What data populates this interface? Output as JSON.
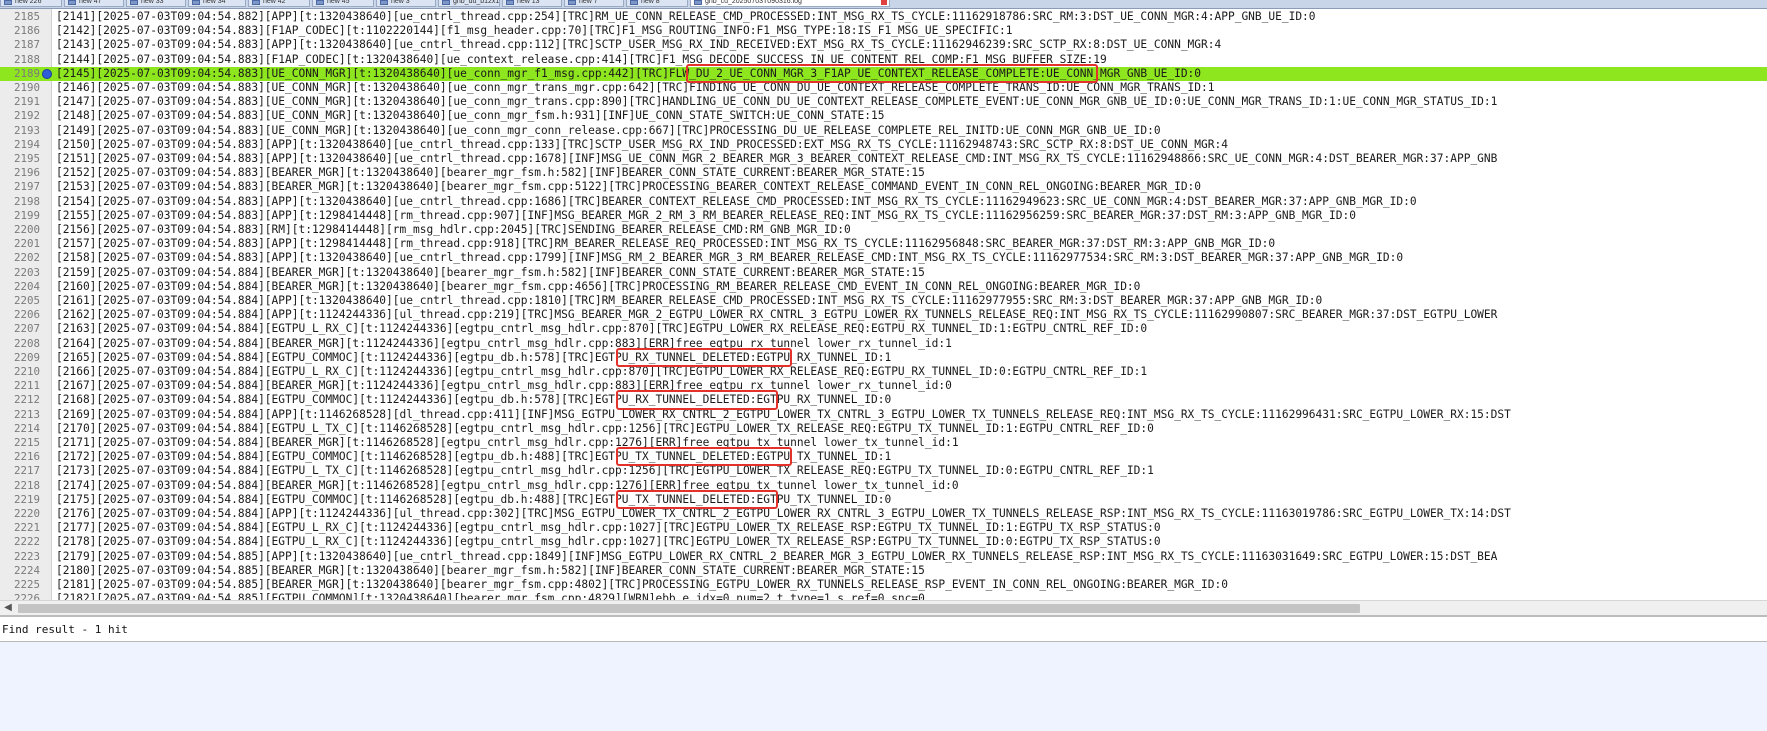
{
  "tabs": [
    {
      "label": "new 226"
    },
    {
      "label": "new 47"
    },
    {
      "label": "new 33"
    },
    {
      "label": "new 34"
    },
    {
      "label": "new 42"
    },
    {
      "label": "new 45"
    },
    {
      "label": "new 3"
    },
    {
      "label": "gnb_du_b12x1.1.log"
    },
    {
      "label": "new 13"
    },
    {
      "label": "new 7"
    },
    {
      "label": "new 8"
    },
    {
      "label": "gnb_cu_20250703T090316.log"
    }
  ],
  "log": {
    "lines": [
      {
        "ln": "2185",
        "text": "[2141][2025-07-03T09:04:54.882][APP][t:1320438640][ue_cntrl_thread.cpp:254][TRC]RM_UE_CONN_RELEASE_CMD_PROCESSED:INT_MSG_RX_TS_CYCLE:11162918786:SRC_RM:3:DST_UE_CONN_MGR:4:APP_GNB_UE_ID:0"
      },
      {
        "ln": "2186",
        "text": "[2142][2025-07-03T09:04:54.883][F1AP_CODEC][t:1102220144][f1_msg_header.cpp:70][TRC]F1_MSG_ROUTING_INFO:F1_MSG_TYPE:18:IS_F1_MSG_UE_SPECIFIC:1"
      },
      {
        "ln": "2187",
        "text": "[2143][2025-07-03T09:04:54.883][APP][t:1320438640][ue_cntrl_thread.cpp:112][TRC]SCTP_USER_MSG_RX_IND_RECEIVED:EXT_MSG_RX_TS_CYCLE:11162946239:SRC_SCTP_RX:8:DST_UE_CONN_MGR:4"
      },
      {
        "ln": "2188",
        "text": "[2144][2025-07-03T09:04:54.883][F1AP_CODEC][t:1320438640][ue_context_release.cpp:414][TRC]F1_MSG_DECODE_SUCCESS_IN_UE_CONTENT_REL_COMP:F1_MSG_BUFFER_SIZE:19"
      },
      {
        "ln": "2189",
        "text": "[2145][2025-07-03T09:04:54.883][UE_CONN_MGR][t:1320438640][ue_conn_mgr_f1_msg.cpp:442][TRC]FLW_DU_2_UE_CONN_MGR_3_F1AP_UE_CONTEXT_RELEASE_COMPLETE:UE_CONN_MGR_GNB_UE_ID:0"
      },
      {
        "ln": "2190",
        "text": "[2146][2025-07-03T09:04:54.883][UE_CONN_MGR][t:1320438640][ue_conn_mgr_trans_mgr.cpp:642][TRC]FINDING_UE_CONN_DU_UE_CONTEXT_RELEASE_COMPLETE_TRANS_ID:UE_CONN_MGR_TRANS_ID:1"
      },
      {
        "ln": "2191",
        "text": "[2147][2025-07-03T09:04:54.883][UE_CONN_MGR][t:1320438640][ue_conn_mgr_trans.cpp:890][TRC]HANDLING_UE_CONN_DU_UE_CONTEXT_RELEASE_COMPLETE_EVENT:UE_CONN_MGR_GNB_UE_ID:0:UE_CONN_MGR_TRANS_ID:1:UE_CONN_MGR_STATUS_ID:1"
      },
      {
        "ln": "2192",
        "text": "[2148][2025-07-03T09:04:54.883][UE_CONN_MGR][t:1320438640][ue_conn_mgr_fsm.h:931][INF]UE_CONN_STATE_SWITCH:UE_CONN_STATE:15"
      },
      {
        "ln": "2193",
        "text": "[2149][2025-07-03T09:04:54.883][UE_CONN_MGR][t:1320438640][ue_conn_mgr_conn_release.cpp:667][TRC]PROCESSING_DU_UE_RELEASE_COMPLETE_REL_INITD:UE_CONN_MGR_GNB_UE_ID:0"
      },
      {
        "ln": "2194",
        "text": "[2150][2025-07-03T09:04:54.883][APP][t:1320438640][ue_cntrl_thread.cpp:133][TRC]SCTP_USER_MSG_RX_IND_PROCESSED:EXT_MSG_RX_TS_CYCLE:11162948743:SRC_SCTP_RX:8:DST_UE_CONN_MGR:4"
      },
      {
        "ln": "2195",
        "text": "[2151][2025-07-03T09:04:54.883][APP][t:1320438640][ue_cntrl_thread.cpp:1678][INF]MSG_UE_CONN_MGR_2_BEARER_MGR_3_BEARER_CONTEXT_RELEASE_CMD:INT_MSG_RX_TS_CYCLE:11162948866:SRC_UE_CONN_MGR:4:DST_BEARER_MGR:37:APP_GNB"
      },
      {
        "ln": "2196",
        "text": "[2152][2025-07-03T09:04:54.883][BEARER_MGR][t:1320438640][bearer_mgr_fsm.h:582][INF]BEARER_CONN_STATE_CURRENT:BEARER_MGR_STATE:15"
      },
      {
        "ln": "2197",
        "text": "[2153][2025-07-03T09:04:54.883][BEARER_MGR][t:1320438640][bearer_mgr_fsm.cpp:5122][TRC]PROCESSING_BEARER_CONTEXT_RELEASE_COMMAND_EVENT_IN_CONN_REL_ONGOING:BEARER_MGR_ID:0"
      },
      {
        "ln": "2198",
        "text": "[2154][2025-07-03T09:04:54.883][APP][t:1320438640][ue_cntrl_thread.cpp:1686][TRC]BEARER_CONTEXT_RELEASE_CMD_PROCESSED:INT_MSG_RX_TS_CYCLE:11162949623:SRC_UE_CONN_MGR:4:DST_BEARER_MGR:37:APP_GNB_MGR_ID:0"
      },
      {
        "ln": "2199",
        "text": "[2155][2025-07-03T09:04:54.883][APP][t:1298414448][rm_thread.cpp:907][INF]MSG_BEARER_MGR_2_RM_3_RM_BEARER_RELEASE_REQ:INT_MSG_RX_TS_CYCLE:11162956259:SRC_BEARER_MGR:37:DST_RM:3:APP_GNB_MGR_ID:0"
      },
      {
        "ln": "2200",
        "text": "[2156][2025-07-03T09:04:54.883][RM][t:1298414448][rm_msg_hdlr.cpp:2045][TRC]SENDING_BEARER_RELEASE_CMD:RM_GNB_MGR_ID:0"
      },
      {
        "ln": "2201",
        "text": "[2157][2025-07-03T09:04:54.883][APP][t:1298414448][rm_thread.cpp:918][TRC]RM_BEARER_RELEASE_REQ_PROCESSED:INT_MSG_RX_TS_CYCLE:11162956848:SRC_BEARER_MGR:37:DST_RM:3:APP_GNB_MGR_ID:0"
      },
      {
        "ln": "2202",
        "text": "[2158][2025-07-03T09:04:54.883][APP][t:1320438640][ue_cntrl_thread.cpp:1799][INF]MSG_RM_2_BEARER_MGR_3_RM_BEARER_RELEASE_CMD:INT_MSG_RX_TS_CYCLE:11162977534:SRC_RM:3:DST_BEARER_MGR:37:APP_GNB_MGR_ID:0"
      },
      {
        "ln": "2203",
        "text": "[2159][2025-07-03T09:04:54.884][BEARER_MGR][t:1320438640][bearer_mgr_fsm.h:582][INF]BEARER_CONN_STATE_CURRENT:BEARER_MGR_STATE:15"
      },
      {
        "ln": "2204",
        "text": "[2160][2025-07-03T09:04:54.884][BEARER_MGR][t:1320438640][bearer_mgr_fsm.cpp:4656][TRC]PROCESSING_RM_BEARER_RELEASE_CMD_EVENT_IN_CONN_REL_ONGOING:BEARER_MGR_ID:0"
      },
      {
        "ln": "2205",
        "text": "[2161][2025-07-03T09:04:54.884][APP][t:1320438640][ue_cntrl_thread.cpp:1810][TRC]RM_BEARER_RELEASE_CMD_PROCESSED:INT_MSG_RX_TS_CYCLE:11162977955:SRC_RM:3:DST_BEARER_MGR:37:APP_GNB_MGR_ID:0"
      },
      {
        "ln": "2206",
        "text": "[2162][2025-07-03T09:04:54.884][APP][t:1124244336][ul_thread.cpp:219][TRC]MSG_BEARER_MGR_2_EGTPU_LOWER_RX_CNTRL_3_EGTPU_LOWER_RX_TUNNELS_RELEASE_REQ:INT_MSG_RX_TS_CYCLE:11162990807:SRC_BEARER_MGR:37:DST_EGTPU_LOWER"
      },
      {
        "ln": "2207",
        "text": "[2163][2025-07-03T09:04:54.884][EGTPU_L_RX_C][t:1124244336][egtpu_cntrl_msg_hdlr.cpp:870][TRC]EGTPU_LOWER_RX_RELEASE_REQ:EGTPU_RX_TUNNEL_ID:1:EGTPU_CNTRL_REF_ID:0"
      },
      {
        "ln": "2208",
        "text": "[2164][2025-07-03T09:04:54.884][BEARER_MGR][t:1124244336][egtpu_cntrl_msg_hdlr.cpp:883][ERR]free egtpu rx tunnel lower_rx_tunnel_id:1"
      },
      {
        "ln": "2209",
        "text": "[2165][2025-07-03T09:04:54.884][EGTPU_COMMOC][t:1124244336][egtpu_db.h:578][TRC]EGTPU_RX_TUNNEL_DELETED:EGTPU_RX_TUNNEL_ID:1"
      },
      {
        "ln": "2210",
        "text": "[2166][2025-07-03T09:04:54.884][EGTPU_L_RX_C][t:1124244336][egtpu_cntrl_msg_hdlr.cpp:870][TRC]EGTPU_LOWER_RX_RELEASE_REQ:EGTPU_RX_TUNNEL_ID:0:EGTPU_CNTRL_REF_ID:1"
      },
      {
        "ln": "2211",
        "text": "[2167][2025-07-03T09:04:54.884][BEARER_MGR][t:1124244336][egtpu_cntrl_msg_hdlr.cpp:883][ERR]free egtpu rx tunnel lower_rx_tunnel_id:0"
      },
      {
        "ln": "2212",
        "text": "[2168][2025-07-03T09:04:54.884][EGTPU_COMMOC][t:1124244336][egtpu_db.h:578][TRC]EGTPU_RX_TUNNEL_DELETED:EGTPU_RX_TUNNEL_ID:0"
      },
      {
        "ln": "2213",
        "text": "[2169][2025-07-03T09:04:54.884][APP][t:1146268528][dl_thread.cpp:411][INF]MSG_EGTPU_LOWER_RX_CNTRL_2_EGTPU_LOWER_TX_CNTRL_3_EGTPU_LOWER_TX_TUNNELS_RELEASE_REQ:INT_MSG_RX_TS_CYCLE:11162996431:SRC_EGTPU_LOWER_RX:15:DST"
      },
      {
        "ln": "2214",
        "text": "[2170][2025-07-03T09:04:54.884][EGTPU_L_TX_C][t:1146268528][egtpu_cntrl_msg_hdlr.cpp:1256][TRC]EGTPU_LOWER_TX_RELEASE_REQ:EGTPU_TX_TUNNEL_ID:1:EGTPU_CNTRL_REF_ID:0"
      },
      {
        "ln": "2215",
        "text": "[2171][2025-07-03T09:04:54.884][BEARER_MGR][t:1146268528][egtpu_cntrl_msg_hdlr.cpp:1276][ERR]free egtpu tx tunnel lower_tx_tunnel_id:1"
      },
      {
        "ln": "2216",
        "text": "[2172][2025-07-03T09:04:54.884][EGTPU_COMMOC][t:1146268528][egtpu_db.h:488][TRC]EGTPU_TX_TUNNEL_DELETED:EGTPU_TX_TUNNEL_ID:1"
      },
      {
        "ln": "2217",
        "text": "[2173][2025-07-03T09:04:54.884][EGTPU_L_TX_C][t:1146268528][egtpu_cntrl_msg_hdlr.cpp:1256][TRC]EGTPU_LOWER_TX_RELEASE_REQ:EGTPU_TX_TUNNEL_ID:0:EGTPU_CNTRL_REF_ID:1"
      },
      {
        "ln": "2218",
        "text": "[2174][2025-07-03T09:04:54.884][BEARER_MGR][t:1146268528][egtpu_cntrl_msg_hdlr.cpp:1276][ERR]free egtpu tx tunnel lower_tx_tunnel_id:0"
      },
      {
        "ln": "2219",
        "text": "[2175][2025-07-03T09:04:54.884][EGTPU_COMMOC][t:1146268528][egtpu_db.h:488][TRC]EGTPU_TX_TUNNEL_DELETED:EGTPU_TX_TUNNEL_ID:0"
      },
      {
        "ln": "2220",
        "text": "[2176][2025-07-03T09:04:54.884][APP][t:1124244336][ul_thread.cpp:302][TRC]MSG_EGTPU_LOWER_TX_CNTRL_2_EGTPU_LOWER_RX_CNTRL_3_EGTPU_LOWER_TX_TUNNELS_RELEASE_RSP:INT_MSG_RX_TS_CYCLE:11163019786:SRC_EGTPU_LOWER_TX:14:DST"
      },
      {
        "ln": "2221",
        "text": "[2177][2025-07-03T09:04:54.884][EGTPU_L_RX_C][t:1124244336][egtpu_cntrl_msg_hdlr.cpp:1027][TRC]EGTPU_LOWER_TX_RELEASE_RSP:EGTPU_TX_TUNNEL_ID:1:EGTPU_TX_RSP_STATUS:0"
      },
      {
        "ln": "2222",
        "text": "[2178][2025-07-03T09:04:54.884][EGTPU_L_RX_C][t:1124244336][egtpu_cntrl_msg_hdlr.cpp:1027][TRC]EGTPU_LOWER_TX_RELEASE_RSP:EGTPU_TX_TUNNEL_ID:0:EGTPU_TX_RSP_STATUS:0"
      },
      {
        "ln": "2223",
        "text": "[2179][2025-07-03T09:04:54.885][APP][t:1320438640][ue_cntrl_thread.cpp:1849][INF]MSG_EGTPU_LOWER_RX_CNTRL_2_BEARER_MGR_3_EGTPU_LOWER_RX_TUNNELS_RELEASE_RSP:INT_MSG_RX_TS_CYCLE:11163031649:SRC_EGTPU_LOWER:15:DST_BEA"
      },
      {
        "ln": "2224",
        "text": "[2180][2025-07-03T09:04:54.885][BEARER_MGR][t:1320438640][bearer_mgr_fsm.h:582][INF]BEARER_CONN_STATE_CURRENT:BEARER_MGR_STATE:15"
      },
      {
        "ln": "2225",
        "text": "[2181][2025-07-03T09:04:54.885][BEARER_MGR][t:1320438640][bearer_mgr_fsm.cpp:4802][TRC]PROCESSING_EGTPU_LOWER_RX_TUNNELS_RELEASE_RSP_EVENT_IN_CONN_REL_ONGOING:BEARER_MGR_ID:0"
      },
      {
        "ln": "2226",
        "text": "[2182][2025-07-03T09:04:54.885][EGTPU_COMMON][t:1320438640][bearer_mgr_fsm.cpp:4829][WRN]ebb e idx=0 num=2 t type=1 s ref=0 snc=0"
      }
    ],
    "highlighted_line": "2189",
    "bookmarked_line": "2189"
  },
  "find_panel": {
    "result_label": "Find result - 1 hit"
  },
  "colors": {
    "highlight": "#8ee61e",
    "annotation_box": "#e3322b",
    "bookmark": "#2f5fd8"
  }
}
